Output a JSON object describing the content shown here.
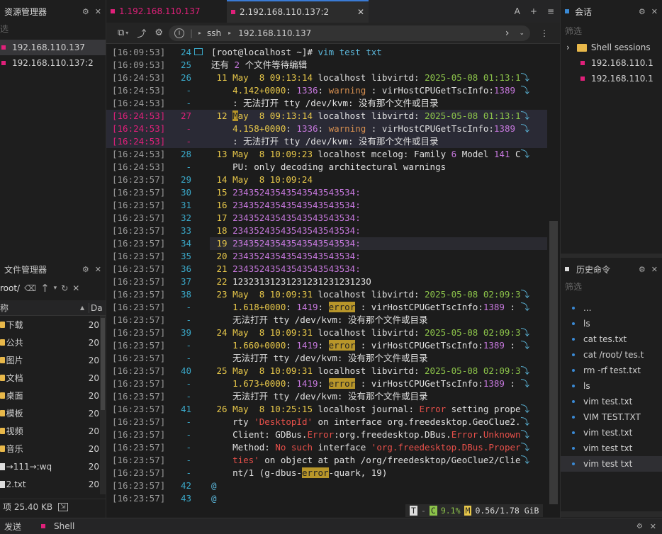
{
  "left": {
    "resources_title": "资源管理器",
    "filter_placeholder": "选",
    "sessions": [
      {
        "label": "192.168.110.137",
        "selected": true
      },
      {
        "label": "192.168.110.137:2",
        "selected": false
      }
    ],
    "files_title": "文件管理器",
    "path": "root/",
    "col_name": "称",
    "col_date": "Da",
    "files": [
      {
        "name": "下载",
        "date": "20",
        "type": "folder"
      },
      {
        "name": "公共",
        "date": "20",
        "type": "folder"
      },
      {
        "name": "图片",
        "date": "20",
        "type": "folder"
      },
      {
        "name": "文档",
        "date": "20",
        "type": "folder"
      },
      {
        "name": "桌面",
        "date": "20",
        "type": "folder"
      },
      {
        "name": "模板",
        "date": "20",
        "type": "folder"
      },
      {
        "name": "视频",
        "date": "20",
        "type": "folder"
      },
      {
        "name": "音乐",
        "date": "20",
        "type": "folder"
      },
      {
        "name": "→111→:wq",
        "date": "20",
        "type": "file"
      },
      {
        "name": "2.txt",
        "date": "20",
        "type": "file"
      }
    ],
    "footer": "项 25.40 KB"
  },
  "tabs": [
    {
      "label": "1.192.168.110.137"
    },
    {
      "label": "2.192.168.110.137:2"
    }
  ],
  "tab_actions": {
    "a": "A",
    "plus": "+",
    "menu": "≡"
  },
  "toolbar": {
    "protocol": "ssh",
    "host": "192.168.110.137"
  },
  "term_lines": [
    {
      "ts": "[16:09:53]",
      "n": "24",
      "segs": [
        [
          "w",
          "[root@localhost ~]# "
        ],
        [
          "c",
          "vim test txt"
        ]
      ]
    },
    {
      "ts": "[16:09:53]",
      "n": "25",
      "segs": [
        [
          "w",
          "还有 "
        ],
        [
          "p",
          "2"
        ],
        [
          "w",
          " 个文件等待编辑"
        ]
      ]
    },
    {
      "ts": "[16:24:53]",
      "n": "26",
      "segs": [
        [
          "y",
          " 11 "
        ],
        [
          "y",
          "May  8 09:13:14 "
        ],
        [
          "w",
          "localhost "
        ],
        [
          "w",
          "libvirtd"
        ],
        [
          "w",
          ": "
        ],
        [
          "g",
          "2025-05-08 01:13:1"
        ],
        [
          "c",
          "⤵"
        ]
      ]
    },
    {
      "ts": "[16:24:53]",
      "n": "-",
      "segs": [
        [
          "y",
          "    4.142+0000"
        ],
        [
          "w",
          ": "
        ],
        [
          "p",
          "1336"
        ],
        [
          "w",
          ": "
        ],
        [
          "o",
          "warning"
        ],
        [
          "w",
          " : virHostCPUGetTscInfo:"
        ],
        [
          "p",
          "1389"
        ],
        [
          "c",
          " ⤵"
        ]
      ]
    },
    {
      "ts": "[16:24:53]",
      "n": "-",
      "segs": [
        [
          "w",
          "    : 无法打开 tty /dev/kvm: 没有那个文件或目录"
        ]
      ]
    },
    {
      "ts": "[16:24:53]",
      "n": "27",
      "red": true,
      "segs": [
        [
          "y",
          " 12 "
        ],
        [
          "hl",
          "M"
        ],
        [
          "y",
          "ay  8 09:13:14 "
        ],
        [
          "w",
          "localhost libvirtd: "
        ],
        [
          "g",
          "2025-05-08 01:13:1"
        ],
        [
          "c",
          "⤵"
        ]
      ]
    },
    {
      "ts": "[16:24:53]",
      "n": "-",
      "red": true,
      "segs": [
        [
          "y",
          "    4.158+0000"
        ],
        [
          "w",
          ": "
        ],
        [
          "p",
          "1336"
        ],
        [
          "w",
          ": "
        ],
        [
          "o",
          "warning"
        ],
        [
          "w",
          " : virHostCPUGetTscInfo:"
        ],
        [
          "p",
          "1389"
        ],
        [
          "c",
          " ⤵"
        ]
      ]
    },
    {
      "ts": "[16:24:53]",
      "n": "-",
      "red": true,
      "segs": [
        [
          "w",
          "    : 无法打开 tty /dev/kvm: 没有那个文件或目录"
        ]
      ]
    },
    {
      "ts": "[16:24:53]",
      "n": "28",
      "segs": [
        [
          "y",
          " 13 May  8 10:09:23 "
        ],
        [
          "w",
          "localhost mcelog: Family "
        ],
        [
          "p",
          "6"
        ],
        [
          "w",
          " Model "
        ],
        [
          "p",
          "141"
        ],
        [
          "w",
          " C"
        ],
        [
          "c",
          "⤵"
        ]
      ]
    },
    {
      "ts": "[16:24:53]",
      "n": "-",
      "segs": [
        [
          "w",
          "    PU: only decoding architectural warnings"
        ]
      ]
    },
    {
      "ts": "[16:23:57]",
      "n": "29",
      "segs": [
        [
          "y",
          " 14 May  8 10:09:24"
        ]
      ]
    },
    {
      "ts": "[16:23:57]",
      "n": "30",
      "segs": [
        [
          "y",
          " 15 "
        ],
        [
          "p",
          "23435243543543543543534:"
        ]
      ]
    },
    {
      "ts": "[16:23:57]",
      "n": "31",
      "segs": [
        [
          "y",
          " 16 "
        ],
        [
          "p",
          "23435243543543543543534:"
        ]
      ]
    },
    {
      "ts": "[16:23:57]",
      "n": "32",
      "segs": [
        [
          "y",
          " 17 "
        ],
        [
          "p",
          "23435243543543543543534:"
        ]
      ]
    },
    {
      "ts": "[16:23:57]",
      "n": "33",
      "segs": [
        [
          "y",
          " 18 "
        ],
        [
          "p",
          "23435243543543543543534:"
        ]
      ]
    },
    {
      "ts": "[16:23:57]",
      "n": "34",
      "cur": true,
      "segs": [
        [
          "y",
          " 19 "
        ],
        [
          "p",
          "23435243543543543543534:"
        ]
      ]
    },
    {
      "ts": "[16:23:57]",
      "n": "35",
      "segs": [
        [
          "y",
          " 20 "
        ],
        [
          "p",
          "23435243543543543543534:"
        ]
      ]
    },
    {
      "ts": "[16:23:57]",
      "n": "36",
      "segs": [
        [
          "y",
          " 21 "
        ],
        [
          "p",
          "23435243543543543543534:"
        ]
      ]
    },
    {
      "ts": "[16:23:57]",
      "n": "37",
      "segs": [
        [
          "y",
          " 22 "
        ],
        [
          "w",
          "1232313123123123123123123O"
        ]
      ]
    },
    {
      "ts": "[16:23:57]",
      "n": "38",
      "segs": [
        [
          "y",
          " 23 May  8 10:09:31 "
        ],
        [
          "w",
          "localhost libvirtd: "
        ],
        [
          "g",
          "2025-05-08 02:09:3"
        ],
        [
          "c",
          "⤵"
        ]
      ]
    },
    {
      "ts": "[16:23:57]",
      "n": "-",
      "segs": [
        [
          "y",
          "    1.618+0000"
        ],
        [
          "w",
          ": "
        ],
        [
          "p",
          "1419"
        ],
        [
          "w",
          ": "
        ],
        [
          "hl",
          "error"
        ],
        [
          "w",
          " : virHostCPUGetTscInfo:"
        ],
        [
          "p",
          "1389"
        ],
        [
          "w",
          " : "
        ],
        [
          "c",
          "⤵"
        ]
      ]
    },
    {
      "ts": "[16:23:57]",
      "n": "-",
      "segs": [
        [
          "w",
          "    无法打开 tty /dev/kvm: 没有那个文件或目录"
        ]
      ]
    },
    {
      "ts": "[16:23:57]",
      "n": "39",
      "segs": [
        [
          "y",
          " 24 May  8 10:09:31 "
        ],
        [
          "w",
          "localhost libvirtd: "
        ],
        [
          "g",
          "2025-05-08 02:09:3"
        ],
        [
          "c",
          "⤵"
        ]
      ]
    },
    {
      "ts": "[16:23:57]",
      "n": "-",
      "segs": [
        [
          "y",
          "    1.660+0000"
        ],
        [
          "w",
          ": "
        ],
        [
          "p",
          "1419"
        ],
        [
          "w",
          ": "
        ],
        [
          "hl",
          "error"
        ],
        [
          "w",
          " : virHostCPUGetTscInfo:"
        ],
        [
          "p",
          "1389"
        ],
        [
          "w",
          " : "
        ],
        [
          "c",
          "⤵"
        ]
      ]
    },
    {
      "ts": "[16:23:57]",
      "n": "-",
      "segs": [
        [
          "w",
          "    无法打开 tty /dev/kvm: 没有那个文件或目录"
        ]
      ]
    },
    {
      "ts": "[16:23:57]",
      "n": "40",
      "segs": [
        [
          "y",
          " 25 May  8 10:09:31 "
        ],
        [
          "w",
          "localhost libvirtd: "
        ],
        [
          "g",
          "2025-05-08 02:09:3"
        ],
        [
          "c",
          "⤵"
        ]
      ]
    },
    {
      "ts": "[16:23:57]",
      "n": "-",
      "segs": [
        [
          "y",
          "    1.673+0000"
        ],
        [
          "w",
          ": "
        ],
        [
          "p",
          "1419"
        ],
        [
          "w",
          ": "
        ],
        [
          "hl",
          "error"
        ],
        [
          "w",
          " : virHostCPUGetTscInfo:"
        ],
        [
          "p",
          "1389"
        ],
        [
          "w",
          " : "
        ],
        [
          "c",
          "⤵"
        ]
      ]
    },
    {
      "ts": "[16:23:57]",
      "n": "-",
      "segs": [
        [
          "w",
          "    无法打开 tty /dev/kvm: 没有那个文件或目录"
        ]
      ]
    },
    {
      "ts": "[16:23:57]",
      "n": "41",
      "segs": [
        [
          "y",
          " 26 May  8 10:25:15 "
        ],
        [
          "w",
          "localhost journal: "
        ],
        [
          "r",
          "Error"
        ],
        [
          "w",
          " setting prope"
        ],
        [
          "c",
          "⤵"
        ]
      ]
    },
    {
      "ts": "[16:23:57]",
      "n": "-",
      "segs": [
        [
          "w",
          "    rty "
        ],
        [
          "r",
          "'DesktopId'"
        ],
        [
          "w",
          " on interface org.freedesktop.GeoClue2."
        ],
        [
          "c",
          "⤵"
        ]
      ]
    },
    {
      "ts": "[16:23:57]",
      "n": "-",
      "segs": [
        [
          "w",
          "    Client: GDBus."
        ],
        [
          "r",
          "Error"
        ],
        [
          "w",
          ":org.freedesktop.DBus."
        ],
        [
          "r",
          "Error"
        ],
        [
          "w",
          "."
        ],
        [
          "r",
          "Unknown"
        ],
        [
          "c",
          "⤵"
        ]
      ]
    },
    {
      "ts": "[16:23:57]",
      "n": "-",
      "segs": [
        [
          "w",
          "    Method: "
        ],
        [
          "r",
          "No such"
        ],
        [
          "w",
          " interface "
        ],
        [
          "r",
          "'org.freedesktop.DBus.Proper"
        ],
        [
          "c",
          "⤵"
        ]
      ]
    },
    {
      "ts": "[16:23:57]",
      "n": "-",
      "segs": [
        [
          "r",
          "    ties'"
        ],
        [
          "w",
          " on object at path /org/freedesktop/GeoClue2/Clie"
        ],
        [
          "c",
          "⤵"
        ]
      ]
    },
    {
      "ts": "[16:23:57]",
      "n": "-",
      "segs": [
        [
          "w",
          "    nt/1 (g-dbus-"
        ],
        [
          "hl",
          "error"
        ],
        [
          "w",
          "-quark, 19)"
        ]
      ]
    },
    {
      "ts": "[16:23:57]",
      "n": "42",
      "segs": [
        [
          "c",
          "@"
        ]
      ]
    },
    {
      "ts": "[16:23:57]",
      "n": "43",
      "segs": [
        [
          "c",
          "@"
        ]
      ]
    }
  ],
  "status": {
    "t": "T",
    "c": "C",
    "cpu": "9.1%",
    "m": "M",
    "mem": "0.56/1.78 GiB"
  },
  "right": {
    "sessions_title": "会话",
    "filter": "筛选",
    "tree": [
      {
        "label": "Shell sessions",
        "type": "folder"
      },
      {
        "label": "192.168.110.1",
        "type": "session"
      },
      {
        "label": "192.168.110.1",
        "type": "session"
      }
    ],
    "history_title": "历史命令",
    "history": [
      "...",
      "ls",
      "cat tes.txt",
      "cat /root/ tes.t",
      "rm -rf test.txt",
      "ls",
      "vim test.txt",
      "VIM TEST.TXT",
      "vim test.txt",
      "vim test txt",
      "vim test txt"
    ]
  },
  "bottom": {
    "send": "发送",
    "shell": "Shell"
  },
  "colors": {
    "accent": "#3a7bd5",
    "pink": "#e0207a"
  }
}
